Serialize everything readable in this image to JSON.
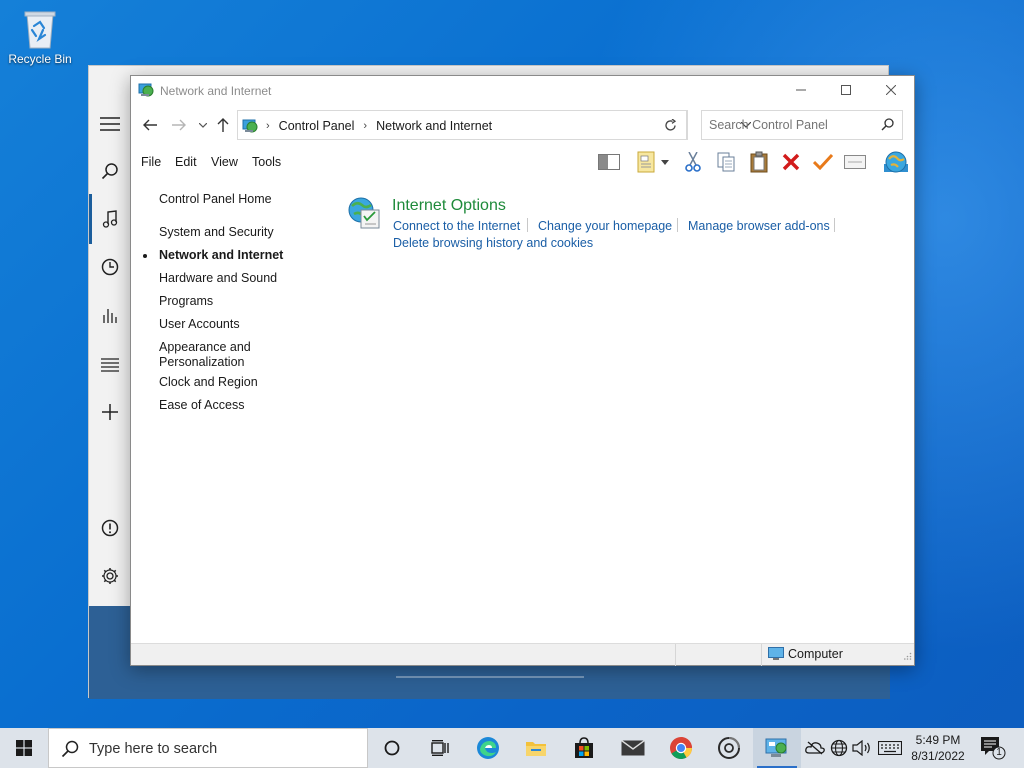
{
  "desktop": {
    "recycle_bin_label": "Recycle Bin"
  },
  "back_app": {
    "rail_icons": [
      "menu-icon",
      "search-icon",
      "music-note-icon",
      "clock-icon",
      "equalizer-icon",
      "playlist-icon",
      "add-icon",
      "info-icon",
      "gear-icon"
    ]
  },
  "window": {
    "title": "Network and Internet",
    "address": {
      "crumbs": [
        "Control Panel",
        "Network and Internet"
      ]
    },
    "search": {
      "placeholder": "Search Control Panel"
    },
    "menu": {
      "file": "File",
      "edit": "Edit",
      "view": "View",
      "tools": "Tools"
    },
    "sidebar": {
      "home": "Control Panel Home",
      "items": [
        {
          "label": "System and Security",
          "current": false
        },
        {
          "label": "Network and Internet",
          "current": true
        },
        {
          "label": "Hardware and Sound",
          "current": false
        },
        {
          "label": "Programs",
          "current": false
        },
        {
          "label": "User Accounts",
          "current": false
        },
        {
          "label": "Appearance and Personalization",
          "current": false
        },
        {
          "label": "Clock and Region",
          "current": false
        },
        {
          "label": "Ease of Access",
          "current": false
        }
      ],
      "appearance_line1": "Appearance and",
      "appearance_line2": "Personalization"
    },
    "category": {
      "title": "Internet Options",
      "links": [
        "Connect to the Internet",
        "Change your homepage",
        "Manage browser add-ons",
        "Delete browsing history and cookies"
      ]
    },
    "status": {
      "zone": "Computer"
    }
  },
  "taskbar": {
    "search_placeholder": "Type here to search",
    "time": "5:49 PM",
    "date": "8/31/2022",
    "notification_count": "1"
  },
  "colors": {
    "link": "#1a5ea6",
    "category_title": "#1e8a3a",
    "desktop": "#0b6fd0",
    "taskbar": "#dde3ea"
  }
}
